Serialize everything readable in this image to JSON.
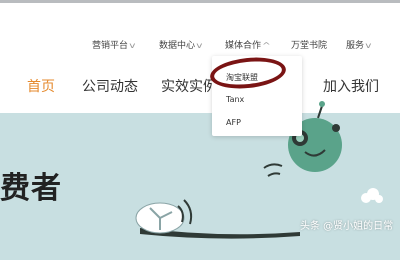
{
  "top_nav": {
    "items": [
      {
        "label": "营销平台",
        "has_dropdown": true
      },
      {
        "label": "数据中心",
        "has_dropdown": true
      },
      {
        "label": "媒体合作",
        "has_dropdown": true
      },
      {
        "label": "万堂书院",
        "has_dropdown": false
      },
      {
        "label": "服务",
        "has_dropdown": true
      }
    ]
  },
  "main_nav": {
    "items": [
      {
        "label": "首页",
        "active": true
      },
      {
        "label": "公司动态",
        "active": false
      },
      {
        "label": "实效实例",
        "active": false
      },
      {
        "label": "加入我们",
        "active": false
      }
    ]
  },
  "dropdown": {
    "items": [
      "淘宝联盟",
      "Tanx",
      "AFP"
    ]
  },
  "hero": {
    "text": "费者"
  },
  "watermark": "头条 @贤小姐的日常",
  "colors": {
    "accent": "#e58a2e",
    "hero_bg": "#c8dfe1",
    "highlight_circle": "#7a1414",
    "robot_green": "#5aa38a"
  },
  "icons": {
    "chevron": "chevron-down-icon",
    "robot": "robot-icon",
    "satellite_dish": "satellite-dish-icon",
    "cloud": "cloud-icon"
  }
}
